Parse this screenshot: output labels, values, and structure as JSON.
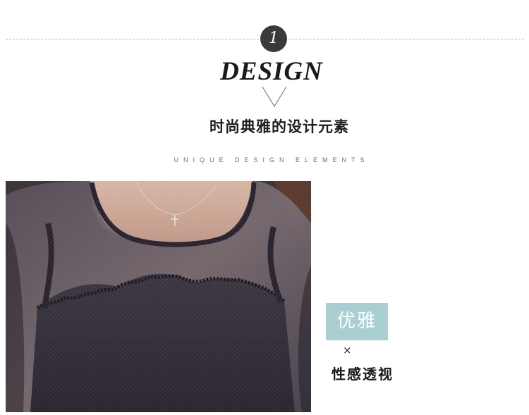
{
  "section": {
    "number": "1",
    "title": "DESIGN",
    "title_cn": "时尚典雅的设计元素",
    "subtitle": "UNIQUE DESIGN ELEMENTS"
  },
  "photo": {
    "icon": "lace-top-detail-photo"
  },
  "tag": {
    "label_primary": "优雅",
    "separator": "×",
    "label_secondary": "性感透视",
    "accent_color": "#a9cfd3"
  }
}
